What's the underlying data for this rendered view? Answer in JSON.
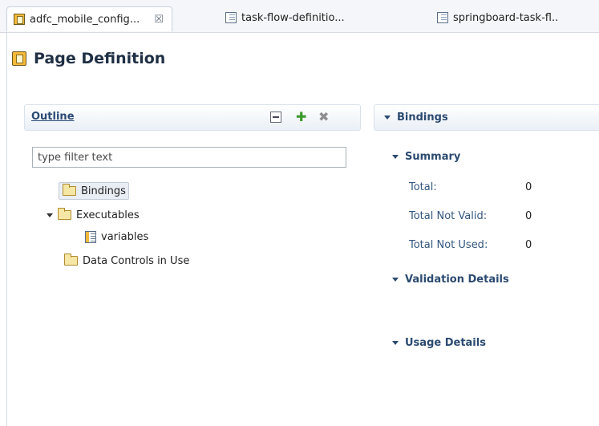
{
  "tabs": [
    {
      "label": "adfc_mobile_config...",
      "close": "☒",
      "icon": "page-definition-icon",
      "active": true
    },
    {
      "label": "task-flow-definitio...",
      "icon": "xml-file-icon",
      "active": false
    },
    {
      "label": "springboard-task-fl..",
      "icon": "xml-file-icon",
      "active": false
    }
  ],
  "page": {
    "title": "Page Definition"
  },
  "outline": {
    "title": "Outline",
    "filter_placeholder": "type filter text",
    "tree": [
      {
        "label": "Bindings",
        "selected": true
      },
      {
        "label": "Executables",
        "expanded": true
      },
      {
        "label": "variables"
      },
      {
        "label": "Data Controls in Use"
      }
    ]
  },
  "bindings": {
    "title": "Bindings",
    "summary": {
      "title": "Summary",
      "rows": [
        {
          "label": "Total:",
          "value": "0"
        },
        {
          "label": "Total Not Valid:",
          "value": "0"
        },
        {
          "label": "Total Not Used:",
          "value": "0"
        }
      ]
    },
    "validation_title": "Validation Details",
    "usage_title": "Usage Details"
  },
  "colors": {
    "accent": "#2b4a70",
    "tab_bg": "#f4f6f9",
    "folder": "#f7e7a6"
  }
}
